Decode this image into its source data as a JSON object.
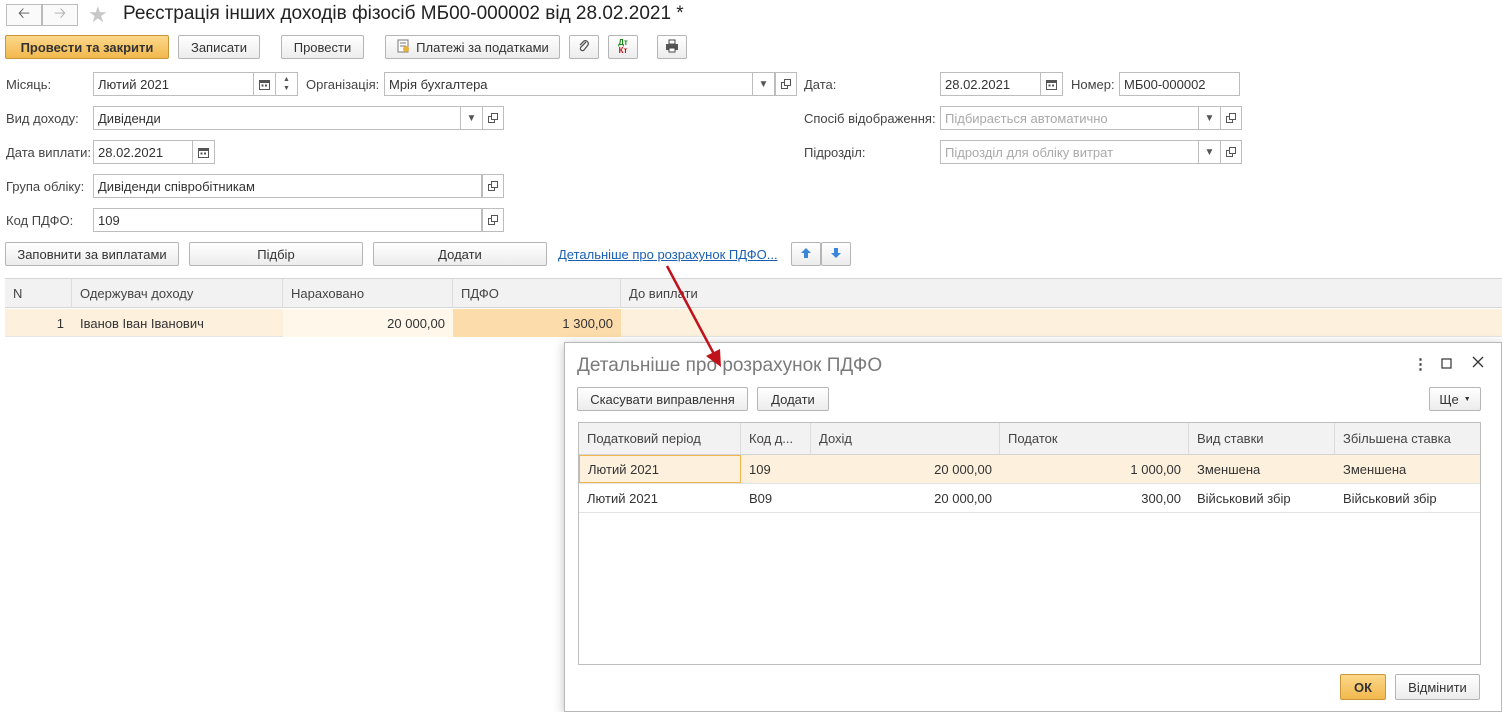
{
  "window": {
    "title": "Реєстрація інших доходів фізосіб МБ00-000002 від 28.02.2021 *"
  },
  "toolbar": {
    "post_close": "Провести та закрити",
    "save": "Записати",
    "post": "Провести",
    "tax_payments": "Платежі за податками",
    "dtkt": "Дт Кт"
  },
  "form": {
    "month_label": "Місяць:",
    "month_value": "Лютий 2021",
    "org_label": "Організація:",
    "org_value": "Мрія бухгалтера",
    "date_label": "Дата:",
    "date_value": "28.02.2021",
    "number_label": "Номер:",
    "number_value": "МБ00-000002",
    "income_type_label": "Вид доходу:",
    "income_type_value": "Дивіденди",
    "display_method_label": "Спосіб відображення:",
    "display_method_placeholder": "Підбирається автоматично",
    "pay_date_label": "Дата виплати:",
    "pay_date_value": "28.02.2021",
    "division_label": "Підрозділ:",
    "division_placeholder": "Підрозділ для обліку витрат",
    "account_group_label": "Група обліку:",
    "account_group_value": "Дивіденди співробітникам",
    "pdfo_code_label": "Код ПДФО:",
    "pdfo_code_value": "109"
  },
  "actions": {
    "fill": "Заповнити за виплатами",
    "pick": "Підбір",
    "add": "Додати",
    "details_link": "Детальніше про розрахунок ПДФО..."
  },
  "table": {
    "columns": [
      "N",
      "Одержувач доходу",
      "Нараховано",
      "ПДФО",
      "До виплати"
    ],
    "rows": [
      {
        "n": "1",
        "recipient": "Іванов Іван Іванович",
        "accrued": "20 000,00",
        "pdfo": "1 300,00",
        "to_pay": ""
      }
    ]
  },
  "dialog": {
    "title": "Детальніше про розрахунок ПДФО",
    "cancel_correction": "Скасувати виправлення",
    "add": "Додати",
    "more": "Ще",
    "columns": [
      "Податковий період",
      "Код д...",
      "Дохід",
      "Податок",
      "Вид ставки",
      "Збільшена ставка"
    ],
    "rows": [
      {
        "period": "Лютий 2021",
        "code": "109",
        "income": "20 000,00",
        "tax": "1 000,00",
        "rate_type": "Зменшена",
        "increased_rate": "Зменшена"
      },
      {
        "period": "Лютий 2021",
        "code": "В09",
        "income": "20 000,00",
        "tax": "300,00",
        "rate_type": "Військовий збір",
        "increased_rate": "Військовий збір"
      }
    ],
    "ok": "ОК",
    "cancel": "Відмінити"
  },
  "colors": {
    "primary_button": "#f2b84d",
    "selected_row": "#fdf1de",
    "link": "#1a5fb4",
    "arrow": "#c0121b"
  }
}
